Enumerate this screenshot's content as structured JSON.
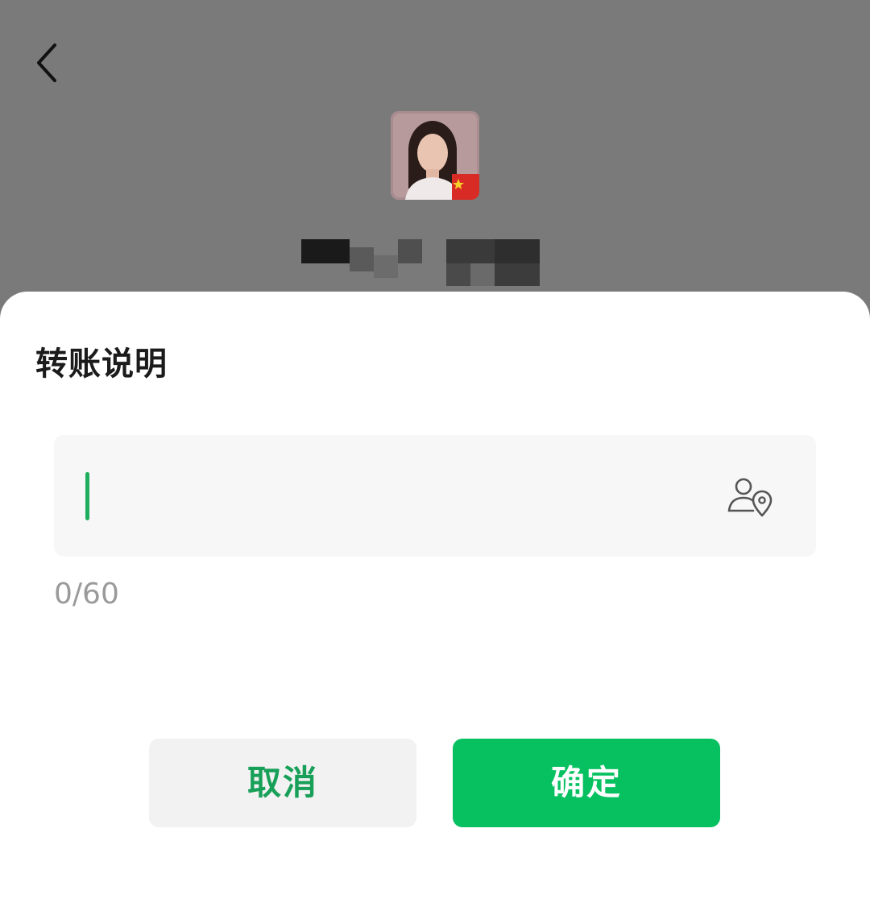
{
  "header": {
    "back_icon": "chevron-left-icon",
    "avatar_icon": "profile-photo-with-china-flag-icon"
  },
  "dialog": {
    "title": "转账说明",
    "input": {
      "value": "",
      "placeholder": "",
      "mention_icon": "person-location-icon"
    },
    "counter": "0/60",
    "cancel_label": "取消",
    "confirm_label": "确定"
  },
  "colors": {
    "overlay_background": "#7a7a7a",
    "accent_green": "#07c160",
    "cancel_text_green": "#18a058",
    "caret_green": "#1fae5e"
  }
}
